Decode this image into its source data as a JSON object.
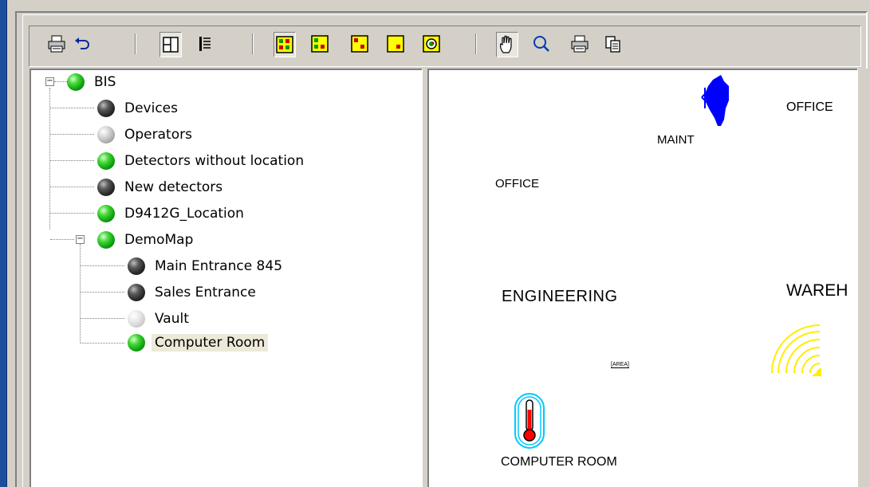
{
  "window": {
    "title_fragment": "..."
  },
  "toolbar": {
    "buttons": [
      {
        "icon": "print-icon"
      },
      {
        "icon": "undo-icon"
      },
      {
        "icon": "layout-tree-map-icon"
      },
      {
        "icon": "list-view-icon"
      },
      {
        "icon": "status-all-icon"
      },
      {
        "icon": "status-alarm-icon"
      },
      {
        "icon": "status-trouble-icon"
      },
      {
        "icon": "status-fault-icon"
      },
      {
        "icon": "search-detector-icon"
      },
      {
        "icon": "hand-pan-icon"
      },
      {
        "icon": "zoom-icon"
      },
      {
        "icon": "print-map-icon"
      },
      {
        "icon": "copy-icon"
      }
    ]
  },
  "tree": {
    "items": [
      {
        "label": "BIS",
        "status": "green"
      },
      {
        "label": "Devices",
        "status": "dark"
      },
      {
        "label": "Operators",
        "status": "gray"
      },
      {
        "label": "Detectors without location",
        "status": "green"
      },
      {
        "label": "New detectors",
        "status": "dark"
      },
      {
        "label": "D9412G_Location",
        "status": "green"
      },
      {
        "label": "DemoMap",
        "status": "green"
      },
      {
        "label": "Main Entrance 845",
        "status": "dark"
      },
      {
        "label": "Sales Entrance",
        "status": "dark"
      },
      {
        "label": "Vault",
        "status": "light"
      },
      {
        "label": "Computer Room",
        "status": "green",
        "selected": true
      }
    ]
  },
  "map": {
    "labels": {
      "office_right": "OFFICE",
      "maint": "MAINT",
      "office_left": "OFFICE",
      "engineering": "ENGINEERING",
      "warehouse": "WAREH",
      "area": "[AREA]",
      "computer_room": "COMPUTER  ROOM"
    },
    "colors": {
      "maint_symbol": "#0000ff",
      "warehouse_signal": "#ffee00",
      "thermometer": "#ff0000",
      "thermo_outline": "#00c8ff"
    }
  }
}
